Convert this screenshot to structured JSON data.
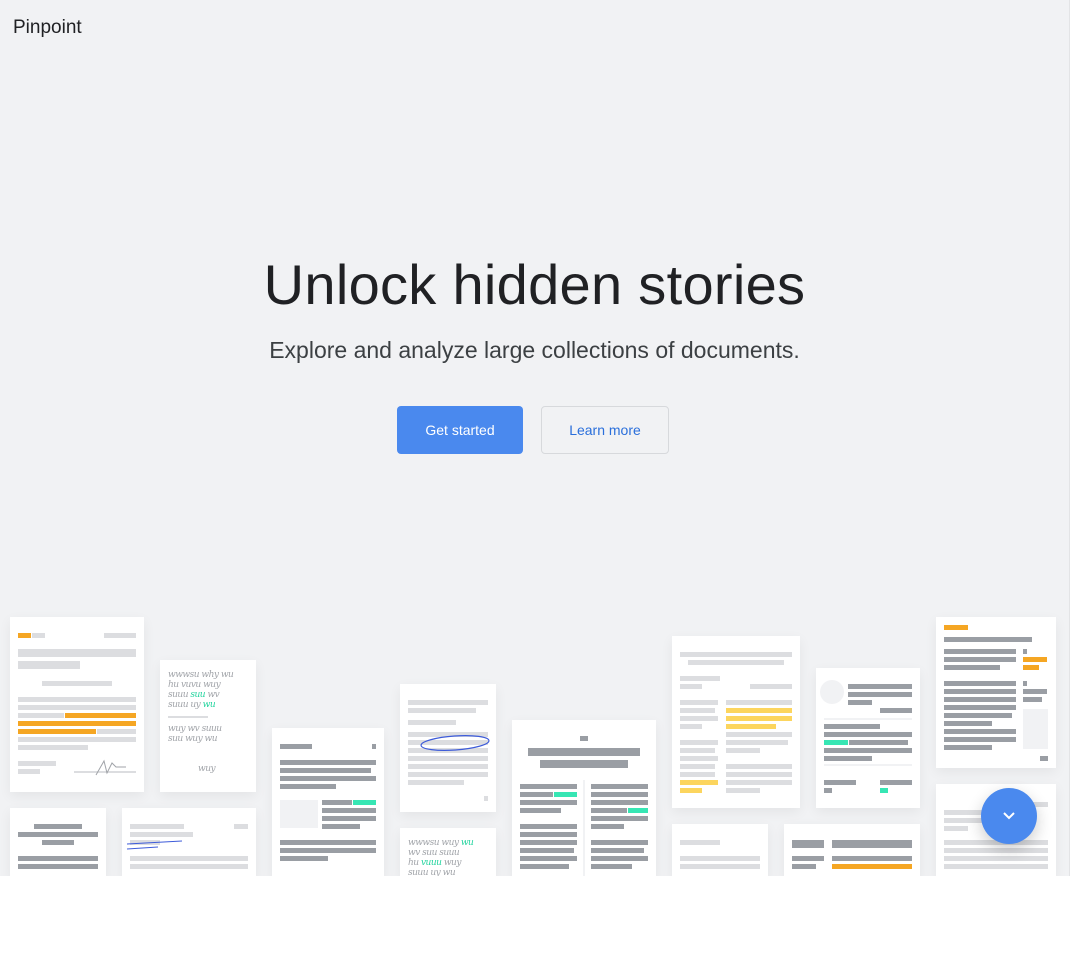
{
  "header": {
    "logo": "Pinpoint"
  },
  "hero": {
    "title": "Unlock hidden stories",
    "subtitle": "Explore and analyze large collections of documents.",
    "primary_button": "Get started",
    "secondary_button": "Learn more"
  },
  "fab": {
    "icon": "chevron-down-icon"
  },
  "colors": {
    "background": "#f1f2f4",
    "accent": "#4a89ee",
    "link": "#2a6fdb",
    "highlight_orange": "#f5a623",
    "highlight_green": "#37e6b4"
  }
}
